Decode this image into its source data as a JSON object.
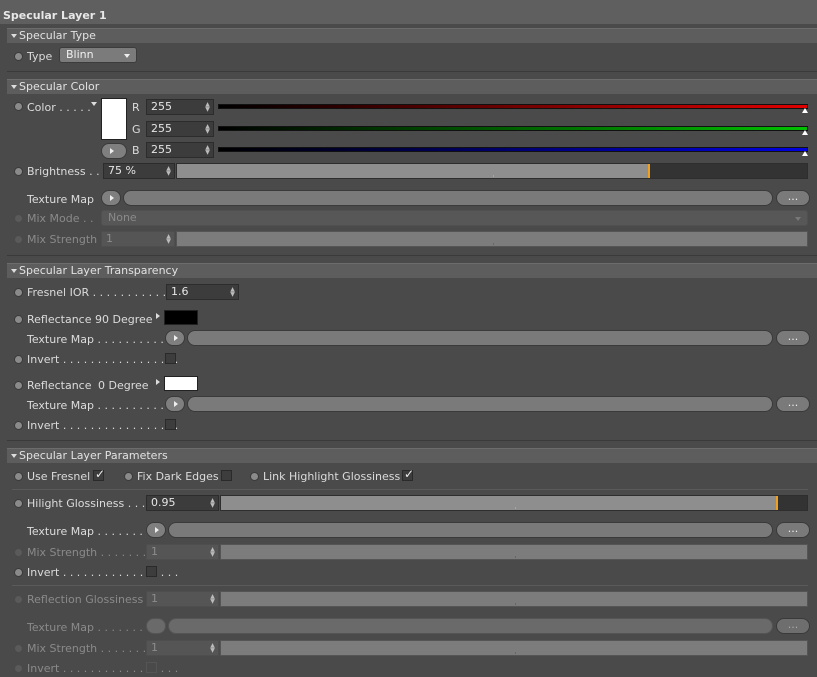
{
  "title": "Specular Layer 1",
  "sections": {
    "type": "Specular Type",
    "color": "Specular Color",
    "transparency": "Specular Layer Transparency",
    "params": "Specular Layer Parameters"
  },
  "type_row": {
    "label": "Type",
    "value": "Blinn"
  },
  "color_row": {
    "label": "Color . . . . .",
    "r_label": "R",
    "g_label": "G",
    "b_label": "B",
    "r": "255",
    "g": "255",
    "b": "255",
    "swatch": "#ffffff"
  },
  "brightness": {
    "label": "Brightness . .",
    "value": "75 %",
    "level": 0.75
  },
  "texture_map_label": "Texture Map",
  "mix_mode": {
    "label": "Mix Mode . .",
    "value": "None"
  },
  "mix_strength": {
    "label": "Mix Strength",
    "value": "1"
  },
  "dots": "...",
  "fresnel_ior": {
    "label": "Fresnel IOR . . . . . . . . . . . .",
    "value": "1.6"
  },
  "refl90": {
    "label": "Reflectance 90 Degree",
    "swatch": "#000000"
  },
  "texmap_dotted": "Texture Map . . . . . . . . . .",
  "invert_dotted": "Invert . . . . . . . . . . . . . . . . .",
  "refl0": {
    "label": "Reflectance",
    "degree": "0 Degree",
    "swatch": "#ffffff"
  },
  "use_fresnel": {
    "label": "Use Fresnel",
    "checked": true
  },
  "fix_dark_edges": {
    "label": "Fix Dark Edges",
    "checked": false
  },
  "link_highlight": {
    "label": "Link Highlight Glossiness",
    "checked": true
  },
  "hilight_gloss": {
    "label": "Hilight Glossiness . . .",
    "value": "0.95",
    "level": 0.95
  },
  "mix_strength2": {
    "label": "Mix Strength . . . . . . . .",
    "value": "1"
  },
  "refl_gloss": {
    "label": "Reflection Glossiness",
    "value": "1"
  },
  "colors": {
    "orange_knob": "#f0a020",
    "red": "#e00000",
    "green": "#00c000",
    "blue": "#0000e0"
  }
}
